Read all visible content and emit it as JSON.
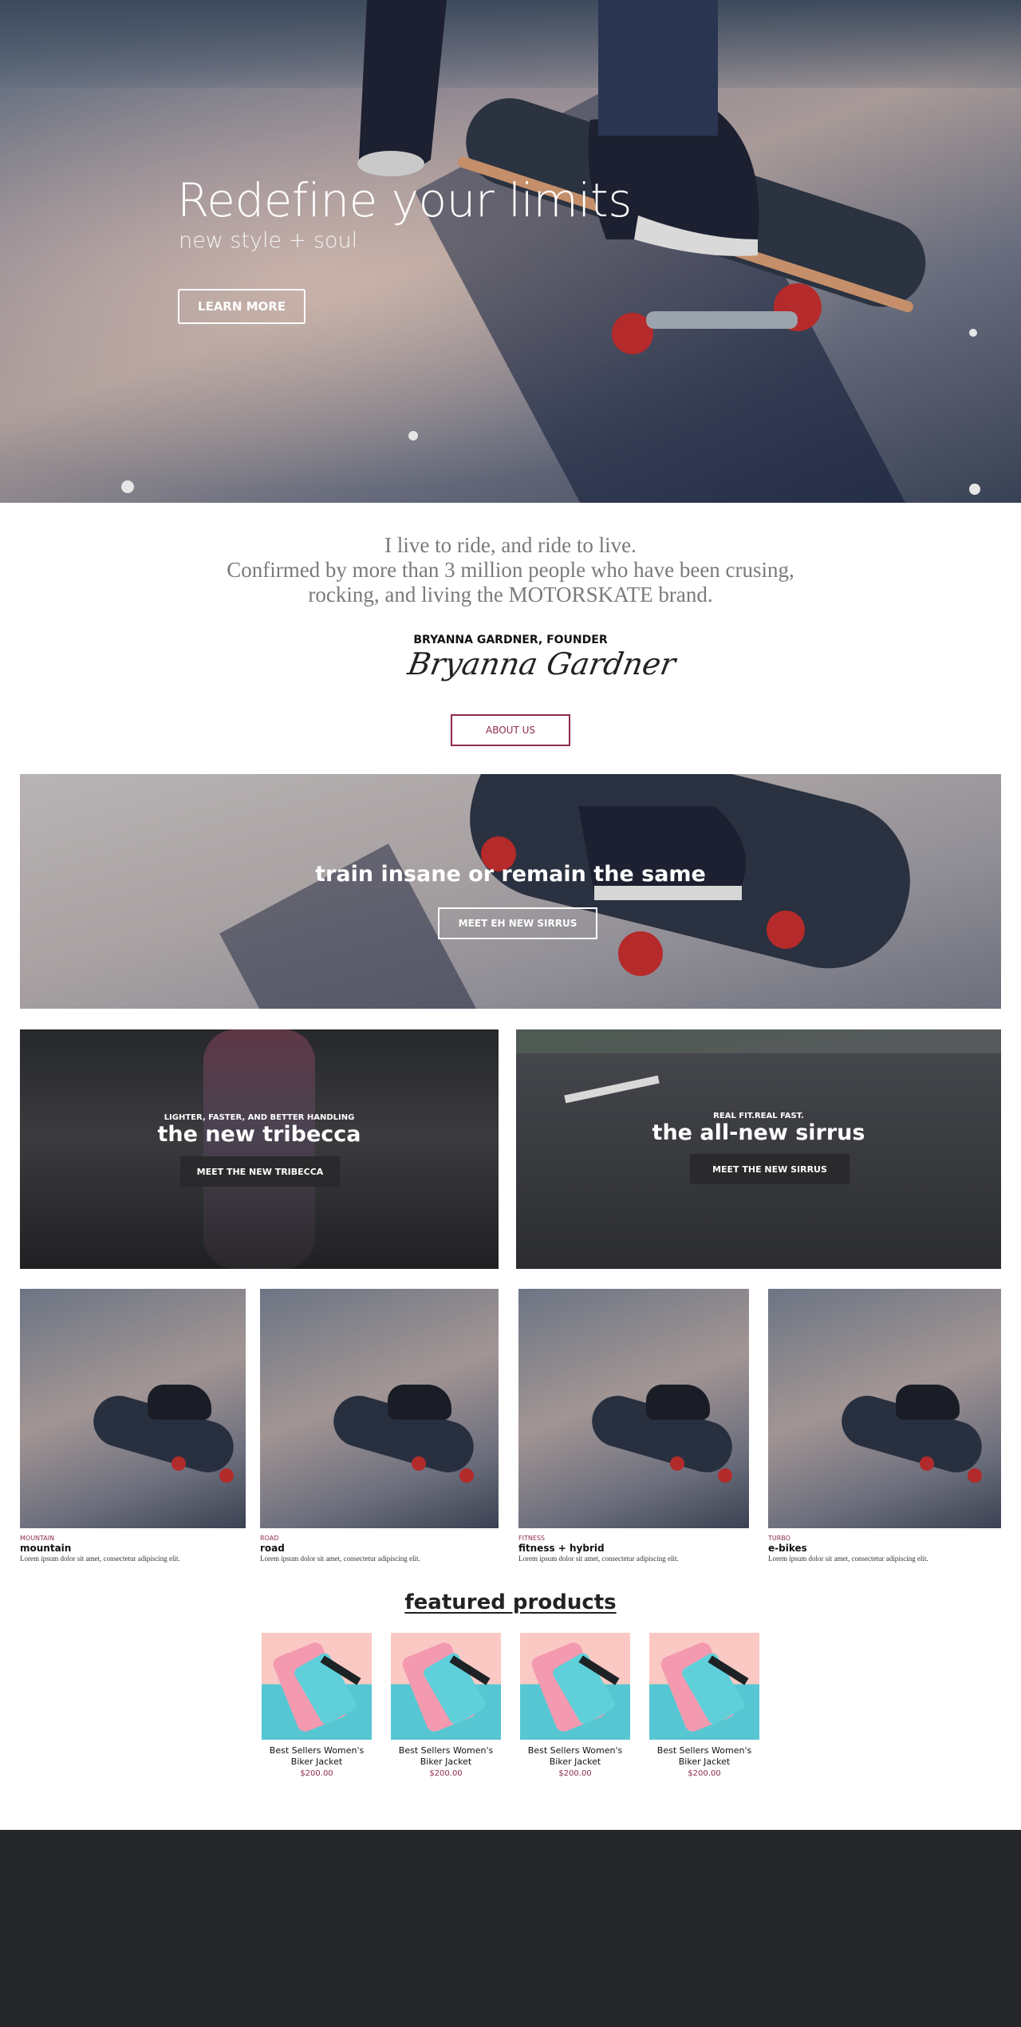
{
  "hero": {
    "title": "Redefine your limits",
    "subtitle": "new style + soul",
    "button": "LEARN MORE"
  },
  "about": {
    "quote_lines": [
      "I live to ride, and ride to live.",
      "Confirmed by more than 3 million people who have been crusing,",
      "rocking, and living the MOTORSKATE brand."
    ],
    "founder": "BRYANNA GARDNER, FOUNDER",
    "signature": "Bryanna Gardner",
    "button": "ABOUT US"
  },
  "banner": {
    "title": "train insane or remain the same",
    "button": "MEET EH NEW SIRRUS"
  },
  "promos": [
    {
      "kicker": "LIGHTER, FASTER, AND BETTER HANDLING",
      "title": "the new tribecca",
      "button": "MEET THE NEW TRIBECCA"
    },
    {
      "kicker": "REAL FIT.REAL FAST.",
      "title": "the all-new sirrus",
      "button": "MEET THE NEW SIRRUS"
    }
  ],
  "categories": [
    {
      "kicker": "MOUNTAIN",
      "name": "mountain",
      "desc": "Lorem ipsum dolor sit amet, consectetur adipiscing elit."
    },
    {
      "kicker": "ROAD",
      "name": "road",
      "desc": "Lorem ipsum dolor sit amet, consectetur adipiscing elit."
    },
    {
      "kicker": "FITNESS",
      "name": "fitness + hybrid",
      "desc": "Lorem ipsum dolor sit amet, consectetur adipiscing elit."
    },
    {
      "kicker": "TURBO",
      "name": "e-bikes",
      "desc": "Lorem ipsum dolor sit amet, consectetur adipiscing elit."
    }
  ],
  "featured": {
    "title": "featured products",
    "products": [
      {
        "name_line1": "Best Sellers Women's",
        "name_line2": "Biker Jacket",
        "price": "$200.00"
      },
      {
        "name_line1": "Best Sellers Women's",
        "name_line2": "Biker Jacket",
        "price": "$200.00"
      },
      {
        "name_line1": "Best Sellers Women's",
        "name_line2": "Biker Jacket",
        "price": "$200.00"
      },
      {
        "name_line1": "Best Sellers Women's",
        "name_line2": "Biker Jacket",
        "price": "$200.00"
      }
    ]
  },
  "colors": {
    "accent": "#8e2c48",
    "footer": "#25262a",
    "product_pink": "#fbc9c3",
    "product_teal": "#56c7d2"
  }
}
